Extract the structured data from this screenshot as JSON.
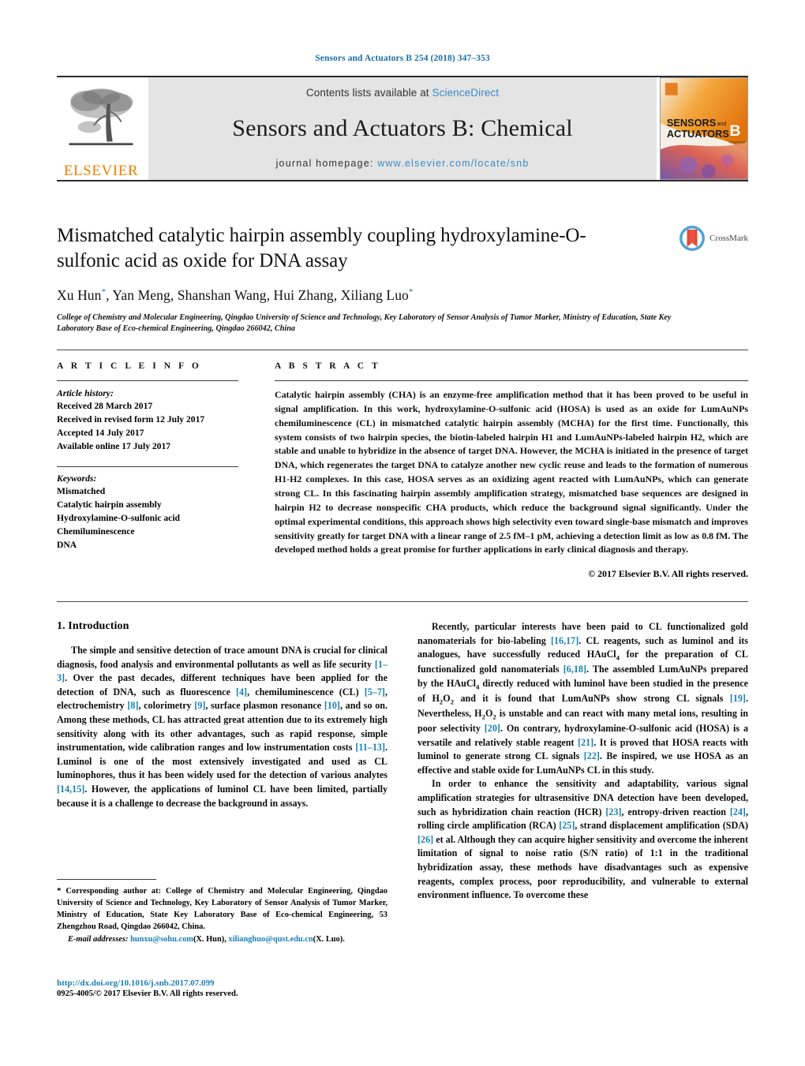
{
  "running_head": "Sensors and Actuators B 254 (2018) 347–353",
  "masthead": {
    "publisher_word": "ELSEVIER",
    "contents_prefix": "Contents lists available at ",
    "contents_link": "ScienceDirect",
    "journal_name": "Sensors and Actuators B: Chemical",
    "homepage_prefix": "journal homepage: ",
    "homepage_url": "www.elsevier.com/locate/snb",
    "cover_title_line1": "SENSORS",
    "cover_title_and": "and",
    "cover_title_line2": "ACTUATORS",
    "cover_series": "B",
    "cover_sub": "Chemical"
  },
  "article": {
    "title": "Mismatched catalytic hairpin assembly coupling hydroxylamine-O-sulfonic acid as oxide for DNA assay",
    "authors": "Xu Hun*, Yan Meng, Shanshan Wang, Hui Zhang, Xiliang Luo*",
    "affiliation": "College of Chemistry and Molecular Engineering, Qingdao University of Science and Technology, Key Laboratory of Sensor Analysis of Tumor Marker, Ministry of Education, State Key Laboratory Base of Eco-chemical Engineering, Qingdao 266042, China",
    "crossmark_label": "CrossMark"
  },
  "article_info": {
    "heading": "A R T I C L E   I N F O",
    "history_label": "Article history:",
    "history": [
      "Received 28 March 2017",
      "Received in revised form 12 July 2017",
      "Accepted 14 July 2017",
      "Available online 17 July 2017"
    ],
    "keywords_label": "Keywords:",
    "keywords": [
      "Mismatched",
      "Catalytic hairpin assembly",
      "Hydroxylamine-O-sulfonic acid",
      "Chemiluminescence",
      "DNA"
    ]
  },
  "abstract": {
    "heading": "A B S T R A C T",
    "text": "Catalytic hairpin assembly (CHA) is an enzyme-free amplification method that it has been proved to be useful in signal amplification. In this work, hydroxylamine-O-sulfonic acid (HOSA) is used as an oxide for LumAuNPs chemiluminescence (CL) in mismatched catalytic hairpin assembly (MCHA) for the first time. Functionally, this system consists of two hairpin species, the biotin-labeled hairpin H1 and LumAuNPs-labeled hairpin H2, which are stable and unable to hybridize in the absence of target DNA. However, the MCHA is initiated in the presence of target DNA, which regenerates the target DNA to catalyze another new cyclic reuse and leads to the formation of numerous H1-H2 complexes. In this case, HOSA serves as an oxidizing agent reacted with LumAuNPs, which can generate strong CL. In this fascinating hairpin assembly amplification strategy, mismatched base sequences are designed in hairpin H2 to decrease nonspecific CHA products, which reduce the background signal significantly. Under the optimal experimental conditions, this approach shows high selectivity even toward single-base mismatch and improves sensitivity greatly for target DNA with a linear range of 2.5 fM–1 pM, achieving a detection limit as low as 0.8 fM. The developed method holds a great promise for further applications in early clinical diagnosis and therapy.",
    "copyright": "© 2017 Elsevier B.V. All rights reserved."
  },
  "introduction": {
    "heading": "1.  Introduction",
    "para_left_1_html": "The simple and sensitive detection of trace amount DNA is crucial for clinical diagnosis, food analysis and environmental pollutants as well as life security <span class=\"ref\">[1–3]</span>. Over the past decades, different techniques have been applied for the detection of DNA, such as fluorescence <span class=\"ref\">[4]</span>, chemiluminescence (CL) <span class=\"ref\">[5–7]</span>, electrochemistry <span class=\"ref\">[8]</span>, colorimetry <span class=\"ref\">[9]</span>, surface plasmon resonance <span class=\"ref\">[10]</span>, and so on. Among these methods, CL has attracted great attention due to its extremely high sensitivity along with its other advantages, such as rapid response, simple instrumentation, wide calibration ranges and low instrumentation costs <span class=\"ref\">[11–13]</span>. Luminol is one of the most extensively investigated and used as CL luminophores, thus it has been widely used for the detection of various analytes <span class=\"ref\">[14,15]</span>. However, the applications of luminol CL have been limited, partially because it is a challenge to decrease the background in assays.",
    "para_right_1_html": "Recently, particular interests have been paid to CL functionalized gold nanomaterials for bio-labeling <span class=\"ref\">[16,17]</span>. CL reagents, such as luminol and its analogues, have successfully reduced HAuCl<sub>4</sub> for the preparation of CL functionalized gold nanomaterials <span class=\"ref\">[6,18]</span>. The assembled LumAuNPs prepared by the HAuCl<sub>4</sub> directly reduced with luminol have been studied in the presence of H<sub>2</sub>O<sub>2</sub> and it is found that LumAuNPs show strong CL signals <span class=\"ref\">[19]</span>. Nevertheless, H<sub>2</sub>O<sub>2</sub> is unstable and can react with many metal ions, resulting in poor selectivity <span class=\"ref\">[20]</span>. On contrary, hydroxylamine-O-sulfonic acid (HOSA) is a versatile and relatively stable reagent <span class=\"ref\">[21]</span>. It is proved that HOSA reacts with luminol to generate strong CL signals <span class=\"ref\">[22]</span>. Be inspired, we use HOSA as an effective and stable oxide for LumAuNPs CL in this study.",
    "para_right_2_html": "In order to enhance the sensitivity and adaptability, various signal amplification strategies for ultrasensitive DNA detection have been developed, such as hybridization chain reaction (HCR) <span class=\"ref\">[23]</span>, entropy-driven reaction <span class=\"ref\">[24]</span>, rolling circle amplification (RCA) <span class=\"ref\">[25]</span>, strand displacement amplification (SDA) <span class=\"ref\">[26]</span> et al. Although they can acquire higher sensitivity and overcome the inherent limitation of signal to noise ratio (S/N ratio) of 1:1 in the traditional hybridization assay, these methods have disadvantages such as expensive reagents, complex process, poor reproducibility, and vulnerable to external environment influence. To overcome these"
  },
  "footnote": {
    "corresponding_html": "<span style=\"font-size:11px\">*</span> Corresponding author at: College of Chemistry and Molecular Engineering, Qingdao University of Science and Technology, Key Laboratory of Sensor Analysis of Tumor Marker, Ministry of Education, State Key Laboratory Base of Eco-chemical Engineering, 53 Zhengzhou Road, Qingdao 266042, China.",
    "email_label": "E-mail addresses:",
    "email_1": "hunxu@sohu.com",
    "email_1_person": "(X. Hun)",
    "email_2": "xilianghuo@qust.edu.cn",
    "email_2_person": "(X. Luo)",
    "doi": "http://dx.doi.org/10.1016/j.snb.2017.07.099",
    "issn": "0925-4005/© 2017 Elsevier B.V. All rights reserved."
  },
  "colors": {
    "link": "#1a7fb5",
    "running_head": "#1a6ea8",
    "elsevier_orange": "#F08000",
    "band_grey": "#e4e4e4"
  }
}
